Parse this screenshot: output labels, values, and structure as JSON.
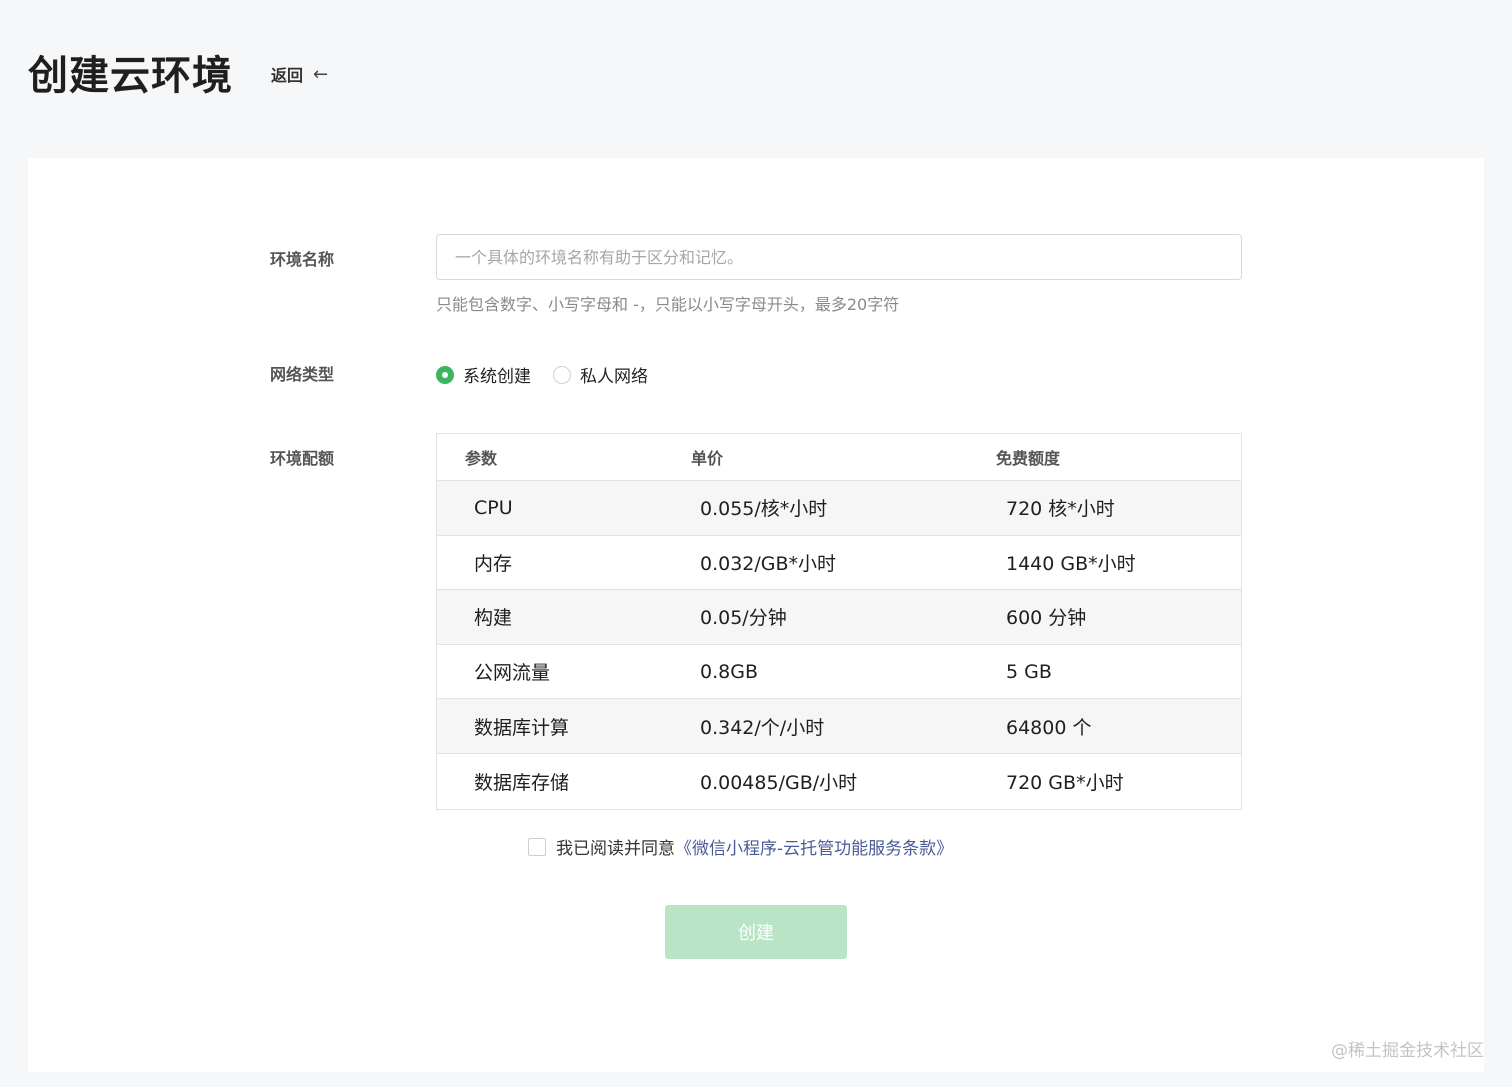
{
  "header": {
    "title": "创建云环境",
    "back_label": "返回",
    "back_icon": "←"
  },
  "form": {
    "name_label": "环境名称",
    "name_placeholder": "一个具体的环境名称有助于区分和记忆。",
    "name_value": "",
    "name_hint": "只能包含数字、小写字母和 -，只能以小写字母开头，最多20字符",
    "network_label": "网络类型",
    "network_options": [
      {
        "label": "系统创建",
        "checked": true
      },
      {
        "label": "私人网络",
        "checked": false
      }
    ],
    "quota_label": "环境配额"
  },
  "table": {
    "headers": [
      "参数",
      "单价",
      "免费额度"
    ],
    "rows": [
      {
        "param": "CPU",
        "price": "0.055/核*小时",
        "free": "720 核*小时"
      },
      {
        "param": "内存",
        "price": "0.032/GB*小时",
        "free": "1440 GB*小时"
      },
      {
        "param": "构建",
        "price": "0.05/分钟",
        "free": "600 分钟"
      },
      {
        "param": "公网流量",
        "price": "0.8GB",
        "free": "5 GB"
      },
      {
        "param": "数据库计算",
        "price": "0.342/个/小时",
        "free": "64800 个"
      },
      {
        "param": "数据库存储",
        "price": "0.00485/GB/小时",
        "free": "720 GB*小时"
      }
    ]
  },
  "agreement": {
    "text": "我已阅读并同意",
    "link": "《微信小程序-云托管功能服务条款》",
    "checked": false
  },
  "submit": {
    "label": "创建",
    "enabled": false
  },
  "watermark": "@稀土掘金技术社区",
  "colors": {
    "accent": "#3cb55e",
    "button_disabled": "#b9e4c5",
    "link": "#4a5c96"
  }
}
